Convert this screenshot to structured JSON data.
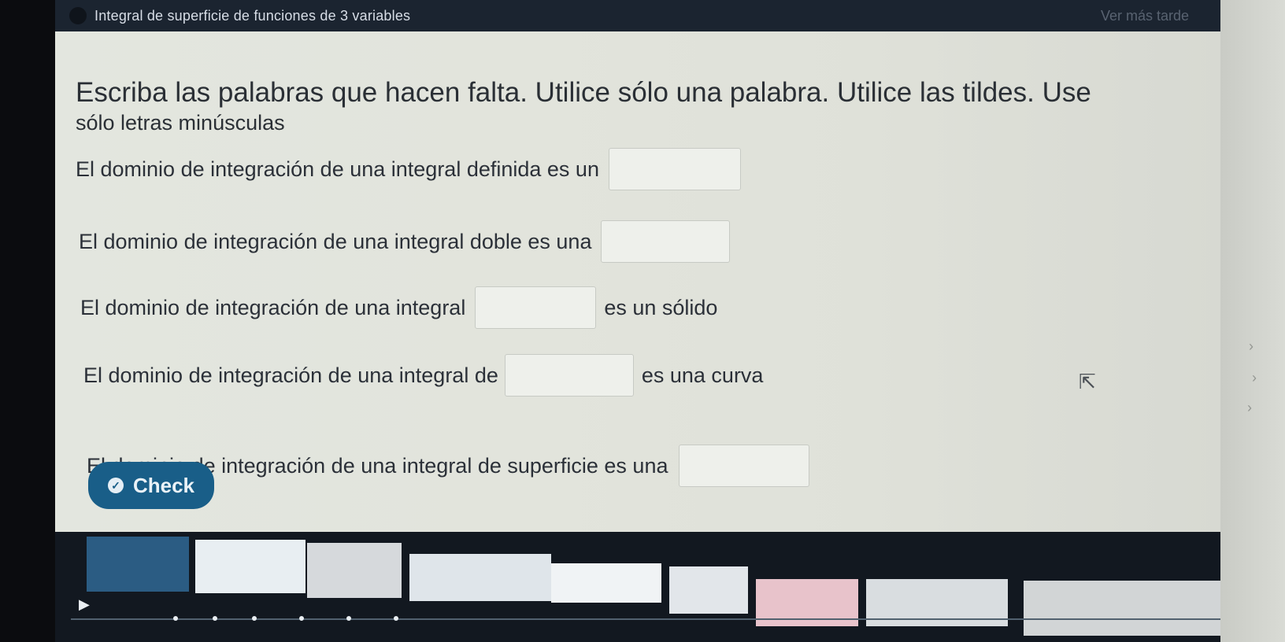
{
  "window": {
    "title": "Integral de superficie de funciones de 3 variables",
    "right_text": "Ver más tarde"
  },
  "instructions": {
    "line1": "Escriba las palabras que hacen falta. Utilice sólo una palabra. Utilice las tildes. Use",
    "line2": "sólo letras minúsculas"
  },
  "questions": [
    {
      "before": "El dominio de integración de una integral definida es un",
      "after": "",
      "value": ""
    },
    {
      "before": "El dominio de integración de una integral doble es una",
      "after": "",
      "value": ""
    },
    {
      "before": "El dominio de integración de una integral",
      "after": "es un sólido",
      "value": ""
    },
    {
      "before": "El dominio de integración de una integral de",
      "after": "es una curva",
      "value": ""
    },
    {
      "before": "El dominio de integración de una integral de superficie es una",
      "after": "",
      "value": ""
    }
  ],
  "check_button": {
    "label": "Check"
  },
  "icons": {
    "check": "check-circle-icon",
    "cursor": "mouse-cursor-icon",
    "play": "play-icon"
  },
  "colors": {
    "accent": "#195e88",
    "titlebar": "#1b2430"
  }
}
